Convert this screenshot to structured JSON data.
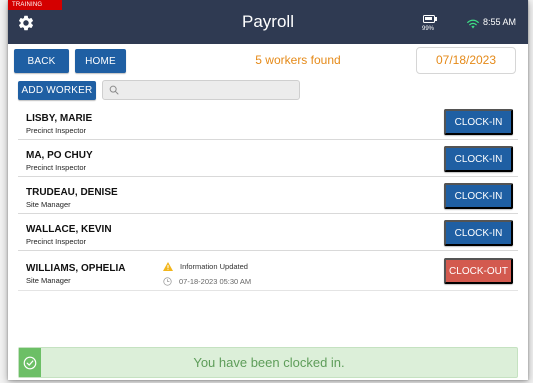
{
  "header": {
    "training_badge": "TRAINING",
    "title": "Payroll",
    "battery_pct": "99%",
    "time": "8:55 AM"
  },
  "toolbar": {
    "back_label": "BACK",
    "home_label": "HOME",
    "workers_found": "5 workers found",
    "date": "07/18/2023",
    "add_worker_label": "ADD WORKER",
    "search_value": ""
  },
  "workers": [
    {
      "name": "LISBY, MARIE",
      "role": "Precinct Inspector",
      "action": "CLOCK-IN"
    },
    {
      "name": "MA, PO CHUY",
      "role": "Precinct Inspector",
      "action": "CLOCK-IN"
    },
    {
      "name": "TRUDEAU, DENISE",
      "role": "Site Manager",
      "action": "CLOCK-IN"
    },
    {
      "name": "WALLACE, KEVIN",
      "role": "Precinct Inspector",
      "action": "CLOCK-IN"
    },
    {
      "name": "WILLIAMS, OPHELIA",
      "role": "Site Manager",
      "action": "CLOCK-OUT",
      "status": "Information Updated",
      "timestamp": "07-18-2023 05:30 AM"
    }
  ],
  "toast": {
    "message": "You have been clocked in."
  },
  "colors": {
    "header_bg": "#2f3a52",
    "primary_button": "#1f5fa3",
    "clock_out_button": "#d35a4f",
    "accent_orange": "#e58a19",
    "training_red": "#d40000",
    "wifi_green": "#3ddc84",
    "toast_bg": "#dcefd9",
    "toast_icon_bg": "#6cbf66"
  },
  "icons": {
    "settings": "gear-icon",
    "battery": "battery-icon",
    "wifi": "wifi-icon",
    "search": "search-icon",
    "warning": "warning-icon",
    "timestamp": "clock-icon",
    "success": "check-circle-icon"
  }
}
